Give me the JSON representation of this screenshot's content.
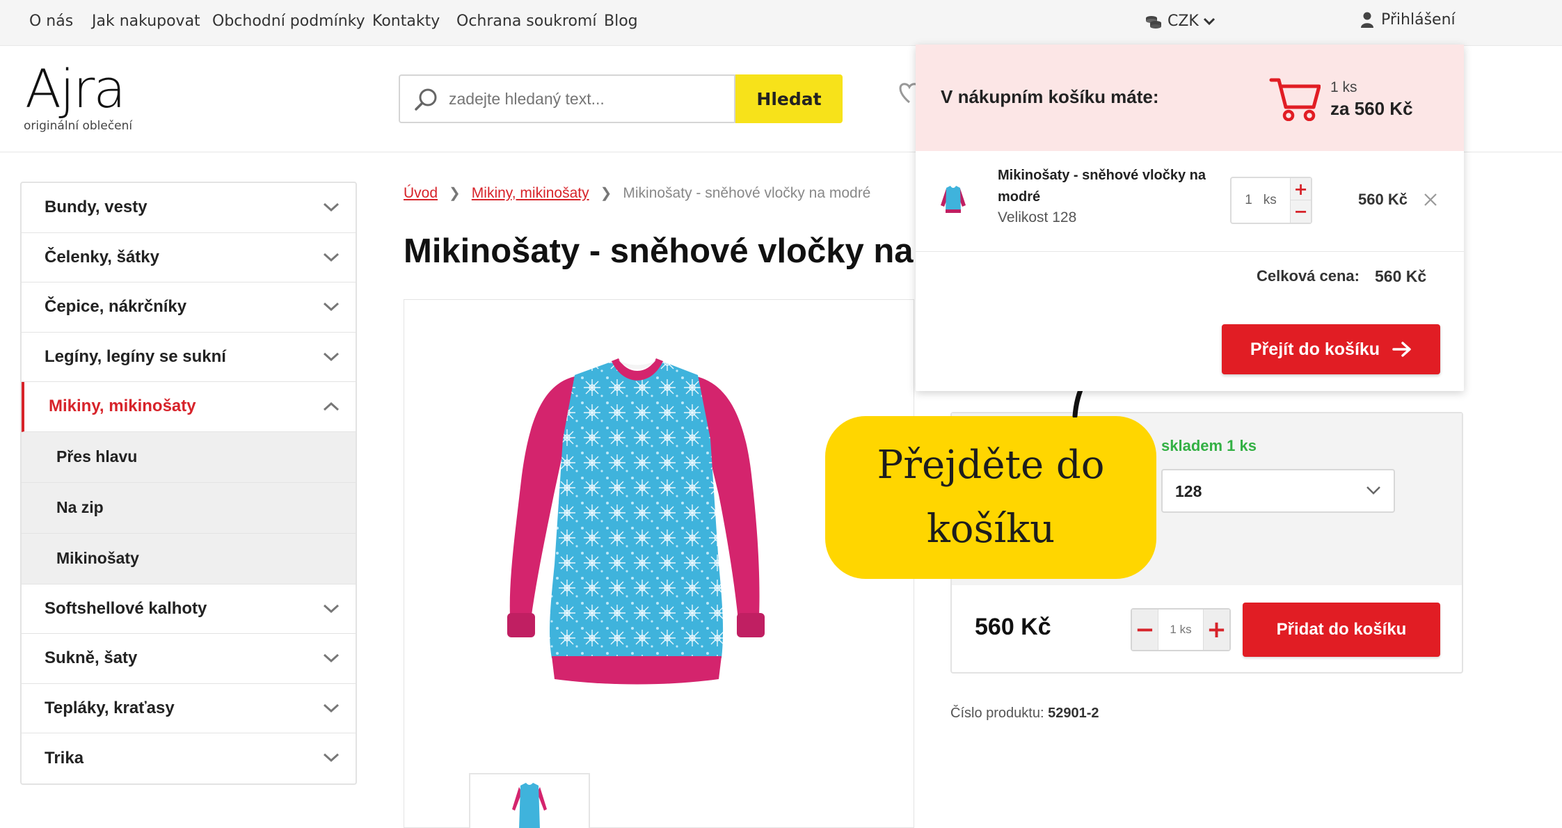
{
  "topnav": {
    "links": [
      "O nás",
      "Jak nakupovat",
      "Obchodní podmínky",
      "Kontakty",
      "Ochrana soukromí",
      "Blog"
    ],
    "currency": "CZK",
    "login": "Přihlášení"
  },
  "header": {
    "logo": "Ajra",
    "logo_sub": "originální oblečení",
    "search_placeholder": "zadejte hledaný text...",
    "search_button": "Hledat"
  },
  "sidebar": {
    "categories": [
      {
        "label": "Bundy, vesty",
        "expanded": false
      },
      {
        "label": "Čelenky, šátky",
        "expanded": false
      },
      {
        "label": "Čepice, nákrčníky",
        "expanded": false
      },
      {
        "label": "Legíny, legíny se sukní",
        "expanded": false
      },
      {
        "label": "Mikiny, mikinošaty",
        "expanded": true,
        "active": true
      },
      {
        "label": "Softshellové kalhoty",
        "expanded": false
      },
      {
        "label": "Sukně, šaty",
        "expanded": false
      },
      {
        "label": "Tepláky, kraťasy",
        "expanded": false
      },
      {
        "label": "Trika",
        "expanded": false
      }
    ],
    "subcategories": [
      "Přes hlavu",
      "Na zip",
      "Mikinošaty"
    ]
  },
  "breadcrumb": {
    "home": "Úvod",
    "category": "Mikiny, mikinošaty",
    "current": "Mikinošaty - sněhové vločky na modré"
  },
  "product": {
    "title": "Mikinošaty - sněhové vločky na",
    "stock": "skladem 1 ks",
    "size": "128",
    "price": "560 Kč",
    "quantity": "1 ks",
    "add_to_cart": "Přidat do košíku",
    "product_number_label": "Číslo produktu:",
    "product_number": "52901-2"
  },
  "cart": {
    "heading": "V nákupním košíku máte:",
    "count": "1 ks",
    "total_head": "za 560 Kč",
    "item": {
      "name": "Mikinošaty - sněhové vločky na modré",
      "size": "Velikost 128",
      "quantity": "1",
      "unit": "ks",
      "price": "560 Kč"
    },
    "total_label": "Celková cena:",
    "total_value": "560 Kč",
    "checkout_button": "Přejít do košíku"
  },
  "callout": {
    "line1": "Přejděte do",
    "line2": "košíku"
  },
  "colors": {
    "accent_red": "#e11d24",
    "search_yellow": "#f7e21a",
    "callout_yellow": "#ffd600",
    "cart_header_pink": "#fce6e6",
    "stock_green": "#33b044"
  }
}
